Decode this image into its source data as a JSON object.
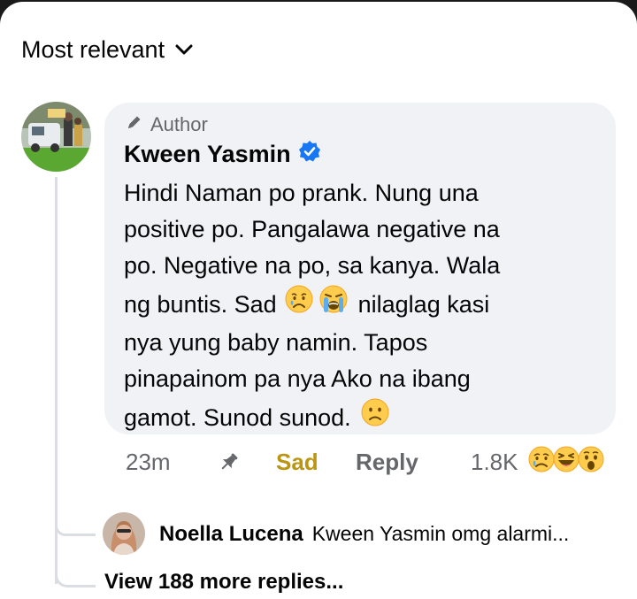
{
  "sort": {
    "label": "Most relevant"
  },
  "comment": {
    "badge": "Author",
    "author": "Kween Yasmin",
    "lines": [
      "Hindi Naman po prank. Nung una",
      "positive po. Pangalawa negative na",
      "po. Negative na po, sa kanya. Wala",
      "ng buntis. Sad",
      "nilaglag kasi",
      "nya yung baby namin. Tapos",
      "pinapainom pa nya Ako na ibang",
      "gamot. Sunod sunod."
    ],
    "inline_emojis": [
      "sad-face-emoji",
      "loudly-crying-face-emoji",
      "frowning-face-emoji"
    ],
    "time": "23m",
    "reaction_selected": "Sad",
    "reply_label": "Reply",
    "reaction_count": "1.8K",
    "reaction_icons": [
      "sad-reaction-icon",
      "haha-reaction-icon",
      "wow-reaction-icon"
    ]
  },
  "reply": {
    "author": "Noella Lucena",
    "snippet": "Kween Yasmin omg alarmi..."
  },
  "more_replies": "View 188 more replies...",
  "colors": {
    "bubble": "#f0f2f5",
    "text": "#050505",
    "muted": "#65676b",
    "sad_label": "#ba9613",
    "verified": "#1877f2",
    "thread_line": "#dadde1"
  }
}
